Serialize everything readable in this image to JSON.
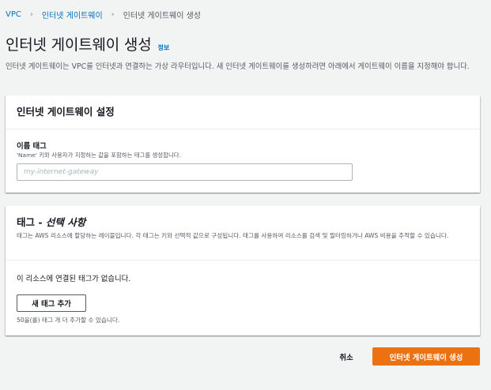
{
  "breadcrumb": {
    "items": [
      "VPC",
      "인터넷 게이트웨이",
      "인터넷 게이트웨이 생성"
    ]
  },
  "header": {
    "title": "인터넷 게이트웨이 생성",
    "info": "정보",
    "description": "인터넷 게이트웨이는 VPC를 인터넷과 연결하는 가상 라우터입니다. 새 인터넷 게이트웨이를 생성하려면 아래에서 게이트웨이 이름을 지정해야 합니다."
  },
  "settings_panel": {
    "title": "인터넷 게이트웨이 설정",
    "name_tag": {
      "label": "이름 태그",
      "description": "'Name' 키와 사용자가 지정하는 값을 포함하는 태그를 생성합니다.",
      "value": "",
      "placeholder": "my-internet-gateway"
    }
  },
  "tags_panel": {
    "title_main": "태그 - ",
    "title_optional": "선택 사항",
    "description": "태그는 AWS 리소스에 할당하는 레이블입니다. 각 태그는 키와 선택적 값으로 구성됩니다. 태그를 사용하여 리소스를 검색 및 필터링하거나 AWS 비용을 추적할 수 있습니다.",
    "empty_message": "이 리소스에 연결된 태그가 없습니다.",
    "add_button": "새 태그 추가",
    "limit_text": "50을(를) 태그 개 더 추가할 수 있습니다."
  },
  "footer": {
    "cancel": "취소",
    "create": "인터넷 게이트웨이 생성"
  },
  "colors": {
    "link": "#0073bb",
    "primary_button": "#ec7211",
    "background": "#f2f3f3"
  }
}
